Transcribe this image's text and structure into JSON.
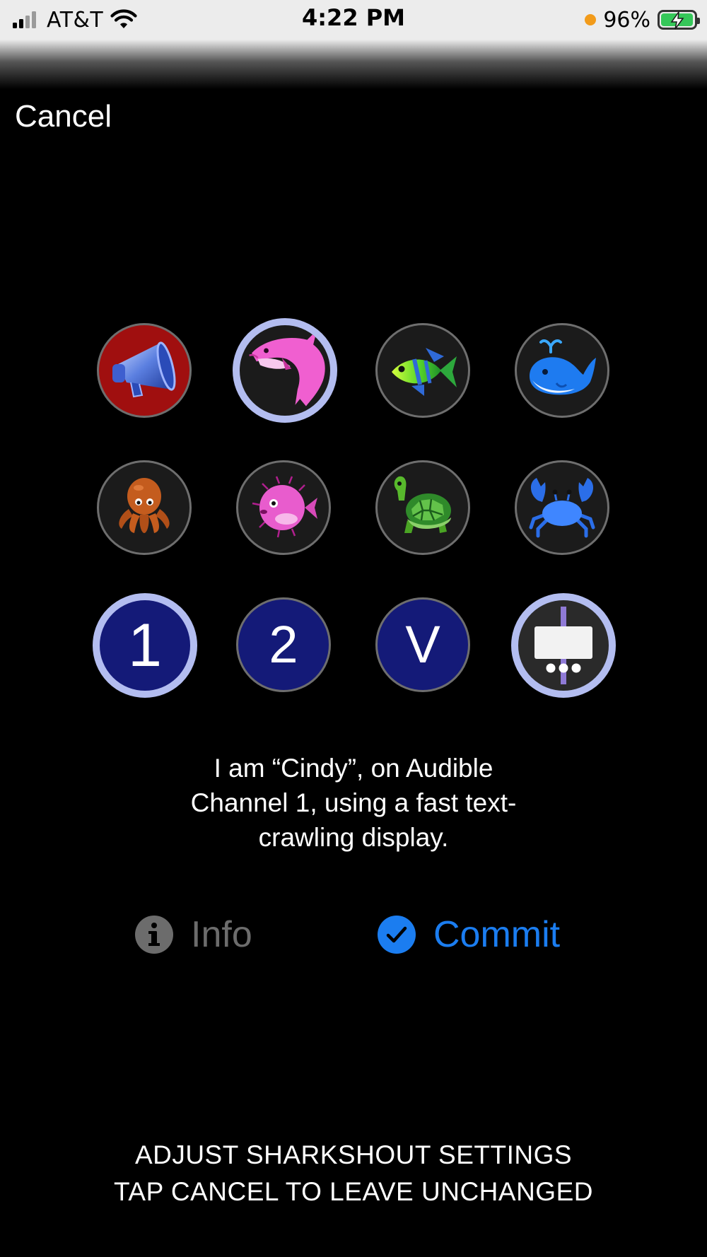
{
  "status_bar": {
    "carrier": "AT&T",
    "time": "4:22 PM",
    "battery_percent": "96%",
    "battery_level": 0.96,
    "signal_bars_active": 2,
    "signal_bars_total": 4,
    "icons": [
      "signal-icon",
      "wifi-icon",
      "recording-dot-icon",
      "battery-charging-icon"
    ]
  },
  "nav": {
    "cancel_label": "Cancel"
  },
  "grid": {
    "row1": [
      {
        "name": "megaphone",
        "icon": "megaphone-icon",
        "selected": false,
        "bg": "#a00f0f"
      },
      {
        "name": "dolphin",
        "icon": "dolphin-icon",
        "selected": true,
        "bg": "#1b1b1b"
      },
      {
        "name": "tropical-fish",
        "icon": "tropical-fish-icon",
        "selected": false,
        "bg": "#1b1b1b"
      },
      {
        "name": "whale",
        "icon": "whale-icon",
        "selected": false,
        "bg": "#1b1b1b"
      }
    ],
    "row2": [
      {
        "name": "octopus",
        "icon": "octopus-icon",
        "selected": false,
        "bg": "#1b1b1b"
      },
      {
        "name": "blowfish",
        "icon": "blowfish-icon",
        "selected": false,
        "bg": "#1b1b1b"
      },
      {
        "name": "turtle",
        "icon": "turtle-icon",
        "selected": false,
        "bg": "#1b1b1b"
      },
      {
        "name": "crab",
        "icon": "crab-icon",
        "selected": false,
        "bg": "#1b1b1b"
      }
    ],
    "row3": [
      {
        "name": "channel-1",
        "label": "1",
        "selected": true,
        "bg": "#141a78"
      },
      {
        "name": "channel-2",
        "label": "2",
        "selected": false,
        "bg": "#141a78"
      },
      {
        "name": "channel-v",
        "label": "V",
        "selected": false,
        "bg": "#141a78"
      },
      {
        "name": "crawl-display",
        "icon": "sign-display-icon",
        "selected": true,
        "bg": "#1b1b1b"
      }
    ]
  },
  "description": {
    "line1": "I am “Cindy”, on Audible",
    "line2": "Channel 1, using a fast text-",
    "line3": "crawling display."
  },
  "actions": {
    "info_label": "Info",
    "commit_label": "Commit",
    "info_color": "#6c6c6c",
    "commit_color": "#1b7df0"
  },
  "footer": {
    "line1": "ADJUST SHARKSHOUT SETTINGS",
    "line2": "TAP CANCEL TO LEAVE UNCHANGED"
  },
  "colors": {
    "selected_ring": "#b3bdf0",
    "navy": "#141a78",
    "background": "#000000"
  }
}
